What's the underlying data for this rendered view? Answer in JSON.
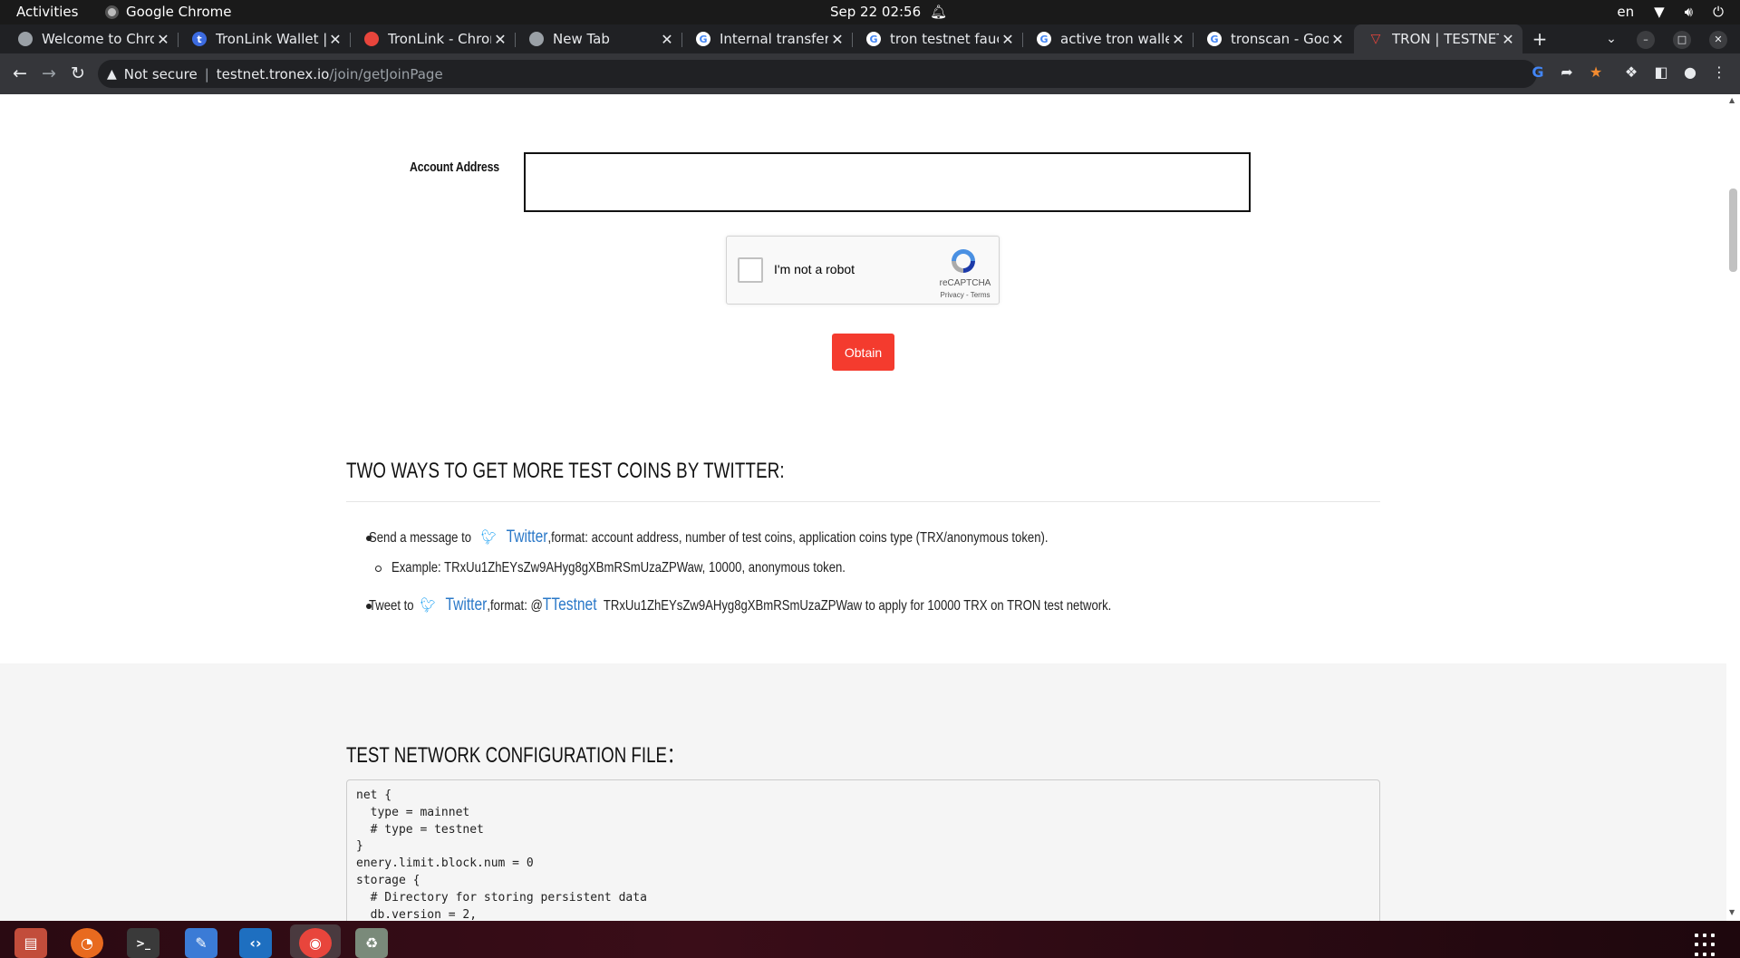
{
  "topbar": {
    "activities": "Activities",
    "app_name": "Google Chrome",
    "clock": "Sep 22  02:56",
    "lang": "en"
  },
  "tabs": [
    {
      "title": "Welcome to Chro",
      "icon": "chrome-icon"
    },
    {
      "title": "TronLink Wallet |",
      "icon": "tronlink-icon"
    },
    {
      "title": "TronLink - Chrom",
      "icon": "webstore-icon"
    },
    {
      "title": "New Tab",
      "icon": "chrome-icon"
    },
    {
      "title": "Internal transfer",
      "icon": "google-icon"
    },
    {
      "title": "tron testnet fauc",
      "icon": "google-icon"
    },
    {
      "title": "active tron wallet",
      "icon": "google-icon"
    },
    {
      "title": "tronscan - Googl",
      "icon": "google-icon"
    },
    {
      "title": "TRON | TESTNET",
      "icon": "tron-icon",
      "active": true
    }
  ],
  "omnibox": {
    "security": "Not secure",
    "separator": "|",
    "host": "testnet.tronex.io",
    "path": "/join/getJoinPage"
  },
  "form": {
    "account_label": "Account Address",
    "account_value": "",
    "captcha_label": "I'm not a robot",
    "captcha_brand": "reCAPTCHA",
    "captcha_links": "Privacy - Terms",
    "obtain_label": "Obtain"
  },
  "twitter_section": {
    "heading": "TWO WAYS TO GET MORE TEST COINS BY TWITTER:",
    "item1_prefix": "Send a message to",
    "item1_link": "Twitter",
    "item1_suffix": ",format: account address, number of test coins, application coins type (TRX/anonymous token).",
    "item1_example": "Example: TRxUu1ZhEYsZw9AHyg8gXBmRSmUzaZPWaw, 10000, anonymous token.",
    "item2_prefix": "Tweet to",
    "item2_link": "Twitter",
    "item2_mid": ",format: @",
    "item2_handle": "TTestnet",
    "item2_suffix": "TRxUu1ZhEYsZw9AHyg8gXBmRSmUzaZPWaw to apply for 10000 TRX on TRON test network."
  },
  "config_section": {
    "heading": "TEST NETWORK CONFIGURATION FILE：",
    "code": "net {\n  type = mainnet\n  # type = testnet\n}\nenery.limit.block.num = 0\nstorage {\n  # Directory for storing persistent data\n  db.version = 2,"
  },
  "dock": {
    "apps": [
      "files-icon",
      "firefox-icon",
      "terminal-icon",
      "text-editor-icon",
      "vscode-icon",
      "chrome-icon",
      "trash-icon"
    ]
  }
}
